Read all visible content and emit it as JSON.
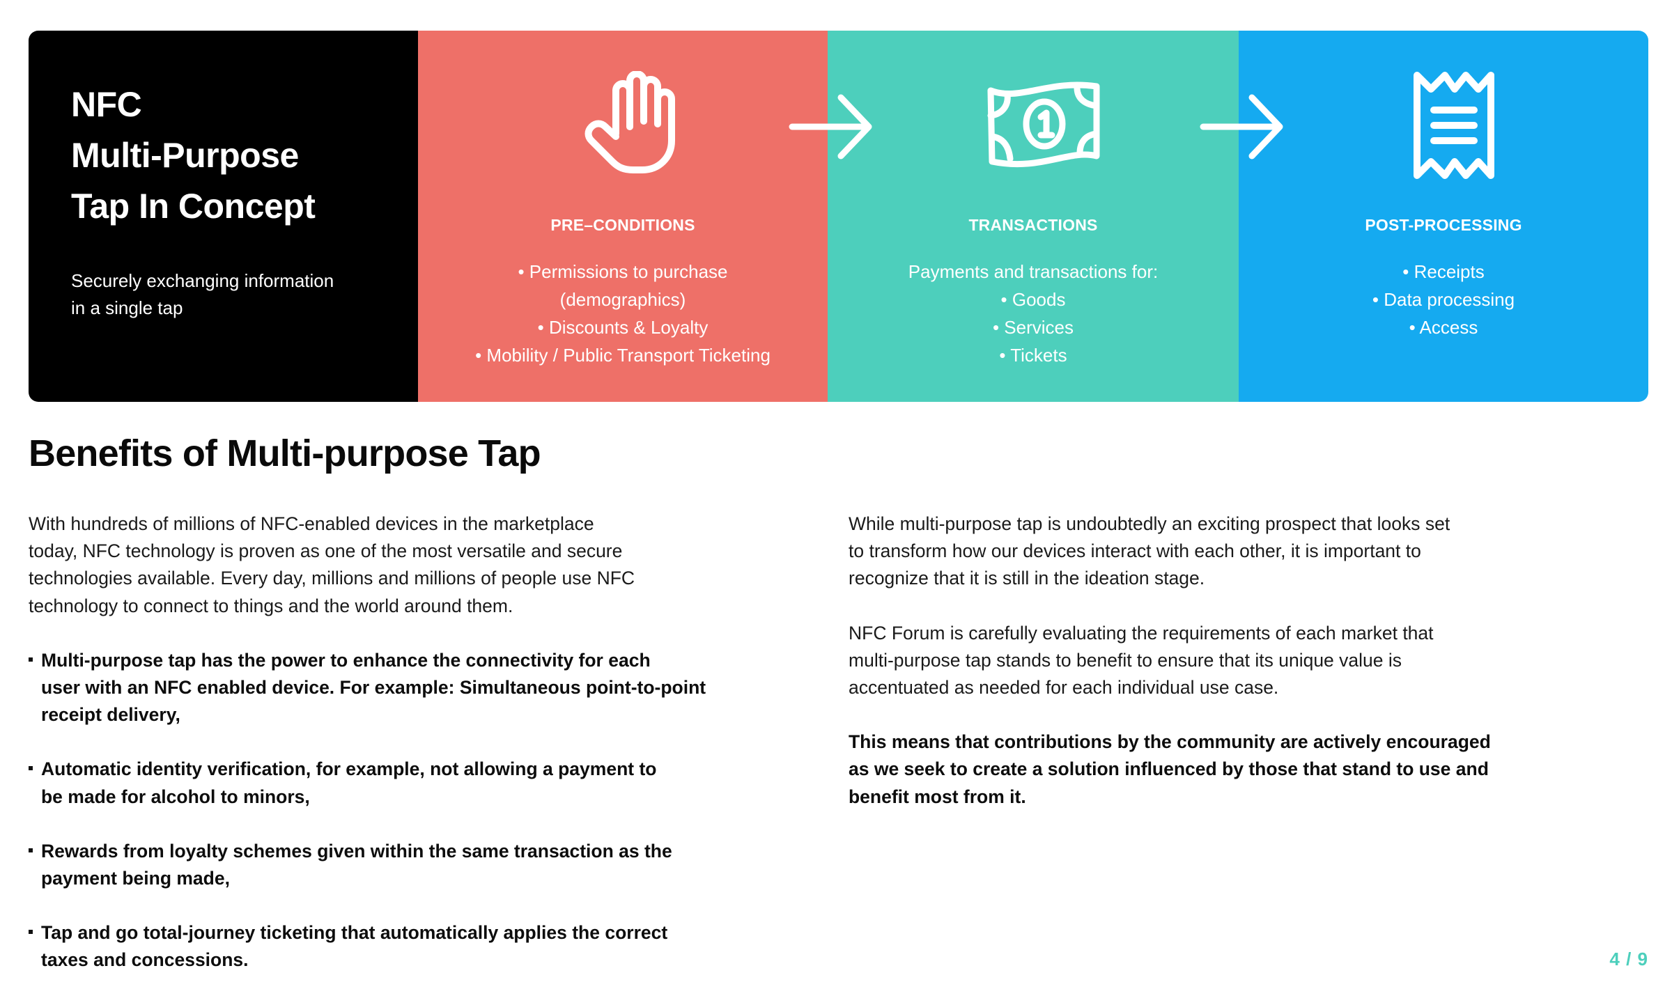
{
  "banner": {
    "intro": {
      "title_lines": [
        "NFC",
        "Multi-Purpose",
        "Tap In Concept"
      ],
      "subtitle_lines": [
        "Securely exchanging information",
        "in a single tap"
      ]
    },
    "stages": [
      {
        "icon": "raised-hand-icon",
        "heading": "PRE–CONDITIONS",
        "lines": [
          "• Permissions to purchase",
          "(demographics)",
          "• Discounts & Loyalty",
          "• Mobility / Public Transport Ticketing"
        ],
        "color": "#EE7068"
      },
      {
        "icon": "banknote-icon",
        "heading": "TRANSACTIONS",
        "lines": [
          "Payments and transactions for:",
          "• Goods",
          "• Services",
          "• Tickets"
        ],
        "color": "#4DCFBC"
      },
      {
        "icon": "receipt-icon",
        "heading": "POST-PROCESSING",
        "lines": [
          "• Receipts",
          "• Data processing",
          "• Access"
        ],
        "color": "#15AAF0"
      }
    ],
    "arrows": [
      "arrow-right-icon",
      "arrow-right-icon"
    ],
    "intro_color": "#000000"
  },
  "article": {
    "title": "Benefits of Multi-purpose Tap",
    "left": {
      "intro_lines": [
        "With hundreds of millions of NFC-enabled devices in the marketplace",
        "today, NFC technology is proven as one of the most versatile and secure",
        "technologies available. Every day, millions and millions of people use NFC",
        "technology to connect to things and the world around them."
      ],
      "bullets": [
        {
          "lines": [
            "Multi-purpose tap has the power to enhance the connectivity for each",
            "user with an NFC enabled device. For example: Simultaneous point-to-point",
            "receipt delivery,"
          ]
        },
        {
          "lines": [
            "Automatic identity verification, for example, not allowing a payment to",
            "be made for alcohol to minors,"
          ]
        },
        {
          "lines": [
            "Rewards from loyalty schemes given within the same transaction as the",
            "payment being made,"
          ]
        },
        {
          "lines": [
            "Tap and go total-journey ticketing that automatically applies the correct",
            "taxes and concessions."
          ]
        }
      ]
    },
    "right": {
      "paragraph1_lines": [
        "While multi-purpose tap is undoubtedly an exciting prospect that looks set",
        "to transform how our devices interact with each other, it is important to",
        "recognize that it is still in the ideation stage."
      ],
      "paragraph2_lines": [
        "NFC Forum is carefully evaluating the requirements of each market that",
        "multi-purpose tap stands to benefit to ensure that its unique value is",
        "accentuated as needed for each individual use case."
      ],
      "paragraph3_lines": [
        "This means that contributions by the community are actively encouraged",
        "as we seek to create a solution influenced by those that stand to use and",
        "benefit most from it."
      ]
    }
  },
  "pagination": {
    "current": "4",
    "total": "9",
    "label": "4 / 9",
    "color": "#4DCFBC"
  }
}
